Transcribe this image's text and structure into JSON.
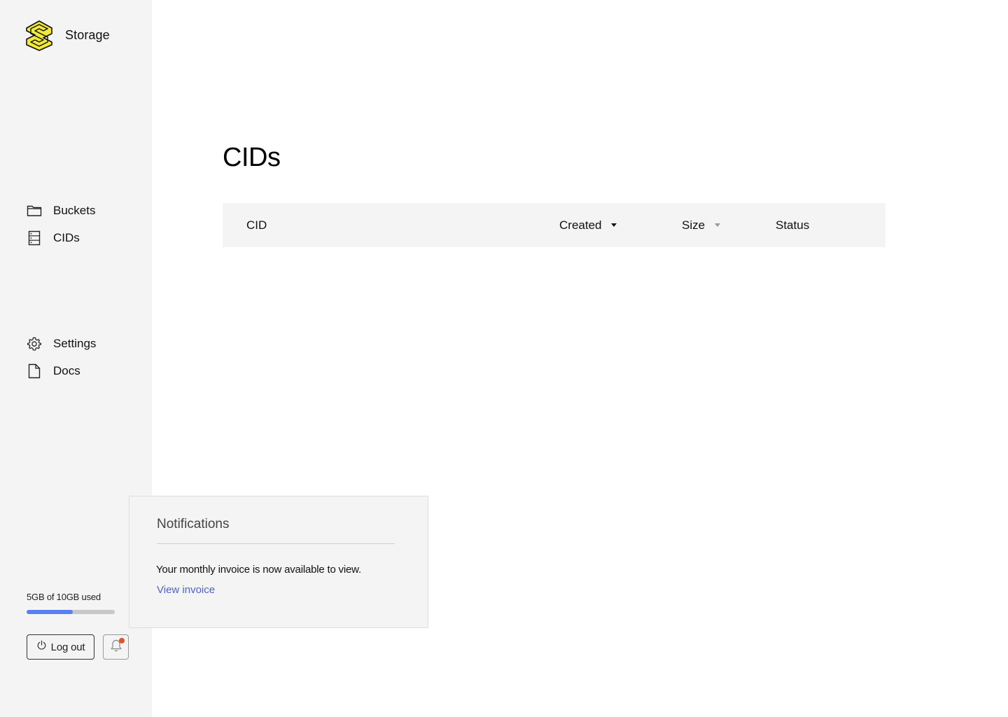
{
  "app": {
    "name": "Storage"
  },
  "nav": {
    "top": [
      {
        "label": "Buckets",
        "icon": "folder-icon"
      },
      {
        "label": "CIDs",
        "icon": "server-icon"
      }
    ],
    "bottom": [
      {
        "label": "Settings",
        "icon": "gear-icon"
      },
      {
        "label": "Docs",
        "icon": "document-icon"
      }
    ]
  },
  "usage": {
    "text": "5GB of 10GB used",
    "used_fraction": 0.52,
    "fill_color": "#5b7ff0"
  },
  "footer": {
    "logout_label": "Log out",
    "logout_icon": "power-icon",
    "bell_icon": "bell-icon",
    "has_unread": true
  },
  "main": {
    "title": "CIDs",
    "table": {
      "columns": [
        {
          "label": "CID",
          "sortable": false
        },
        {
          "label": "Created",
          "sortable": true,
          "sort_active": true
        },
        {
          "label": "Size",
          "sortable": true,
          "sort_active": false
        },
        {
          "label": "Status",
          "sortable": false
        }
      ],
      "rows": []
    }
  },
  "notifications": {
    "title": "Notifications",
    "message": "Your monthly invoice is now available to view.",
    "link_label": "View invoice",
    "link_color": "#4a63d8"
  },
  "colors": {
    "sidebar_bg": "#f4f4f4",
    "accent": "#5b7ff0",
    "badge": "#e0532b",
    "logo": "#f2ea3b"
  }
}
